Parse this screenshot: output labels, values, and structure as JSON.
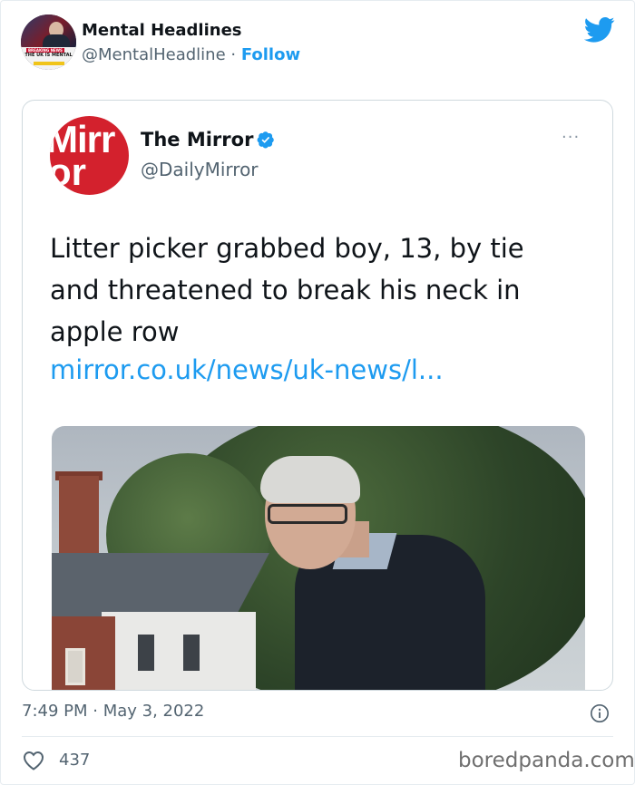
{
  "author": {
    "name": "Mental Headlines",
    "handle": "@MentalHeadline",
    "separator": " · ",
    "follow_label": "Follow",
    "avatar_banner_text": "THE UK IS MENTAL",
    "avatar_break_text": "BREAKING NEWS"
  },
  "quoted_tweet": {
    "logo_text_line1": "Mirr",
    "logo_text_line2": "or",
    "name": "The Mirror",
    "handle": "@DailyMirror",
    "more_label": "···",
    "text": "Litter picker grabbed boy, 13, by tie and threatened to break his neck in apple row",
    "link": "mirror.co.uk/news/uk-news/l..."
  },
  "footer": {
    "timestamp": "7:49 PM · May 3, 2022",
    "likes": "437",
    "watermark": "boredpanda.com"
  },
  "colors": {
    "twitter_blue": "#1d9bf0",
    "mirror_red": "#d3212d",
    "secondary_text": "#536471"
  },
  "icons": {
    "brand": "twitter-bird-icon",
    "verified": "verified-badge-icon",
    "more": "more-options-icon",
    "info": "info-icon",
    "like": "heart-icon"
  }
}
